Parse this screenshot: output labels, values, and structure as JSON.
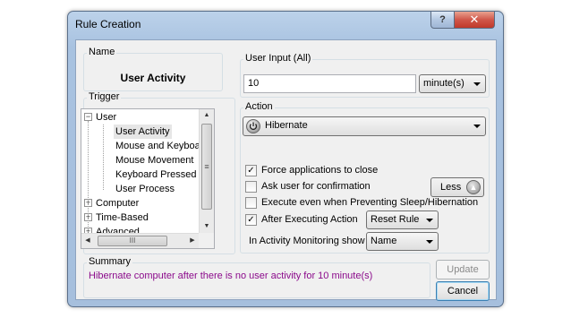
{
  "window": {
    "title": "Rule Creation",
    "help_label": "?",
    "close_label": "✕"
  },
  "name_group": {
    "label": "Name",
    "value": "User Activity"
  },
  "trigger_group": {
    "label": "Trigger",
    "tree": [
      {
        "label": "User",
        "expander": "−"
      },
      {
        "label": "User Activity"
      },
      {
        "label": "Mouse and Keyboard"
      },
      {
        "label": "Mouse Movement"
      },
      {
        "label": "Keyboard Pressed"
      },
      {
        "label": "User Process"
      },
      {
        "label": "Computer",
        "expander": "+"
      },
      {
        "label": "Time-Based",
        "expander": "+"
      },
      {
        "label": "Advanced",
        "expander": "+"
      }
    ],
    "hscroll_left": "◀",
    "hscroll_right": "▶",
    "hscroll_grip": "III",
    "vscroll_up": "▲",
    "vscroll_down": "▼",
    "vscroll_grip": "≡"
  },
  "user_input_group": {
    "label": "User Input (All)",
    "value": "10",
    "unit": "minute(s)"
  },
  "action_group": {
    "label": "Action",
    "action_value": "Hibernate",
    "action_icon": "power-icon",
    "options": [
      {
        "label": "Force applications to close",
        "checked": true,
        "mark": "✓"
      },
      {
        "label": "Ask user for confirmation",
        "checked": false,
        "mark": ""
      },
      {
        "label": "Execute even when Preventing Sleep/Hibernation",
        "checked": false,
        "mark": ""
      },
      {
        "label": "After Executing Action",
        "checked": true,
        "mark": "✓"
      }
    ],
    "less_label": "Less",
    "after_action_value": "Reset Rule",
    "monitoring_label": "In Activity Monitoring show",
    "monitoring_value": "Name"
  },
  "summary_group": {
    "label": "Summary",
    "text": "Hibernate computer after there is no user activity for 10 minute(s)"
  },
  "buttons": {
    "update": "Update",
    "cancel": "Cancel"
  },
  "colors": {
    "summary_text": "#8b0a8b",
    "title_bar": "#b4cbe6",
    "close_button": "#c94b3c"
  }
}
